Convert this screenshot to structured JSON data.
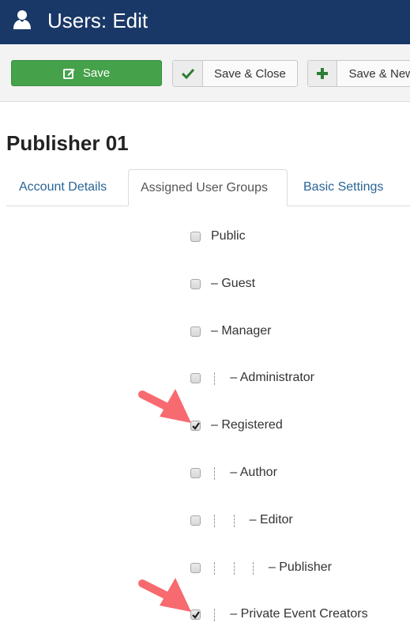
{
  "header": {
    "icon": "user-icon",
    "title": "Users: Edit",
    "background": "#1a3867"
  },
  "toolbar": {
    "save": {
      "label": "Save",
      "icon": "edit-icon",
      "color": "#45a24a"
    },
    "save_close": {
      "label": "Save & Close",
      "icon": "check-icon"
    },
    "save_new": {
      "label": "Save & New",
      "icon": "plus-icon"
    }
  },
  "page": {
    "title": "Publisher 01"
  },
  "tabs": [
    {
      "label": "Account Details",
      "active": false
    },
    {
      "label": "Assigned User Groups",
      "active": true
    },
    {
      "label": "Basic Settings",
      "active": false
    }
  ],
  "groups": [
    {
      "label": "Public",
      "level": 0,
      "checked": false,
      "highlighted": false
    },
    {
      "label": "– Guest",
      "level": 0,
      "checked": false,
      "highlighted": false
    },
    {
      "label": "– Manager",
      "level": 0,
      "checked": false,
      "highlighted": false
    },
    {
      "label": "– Administrator",
      "level": 1,
      "checked": false,
      "highlighted": false
    },
    {
      "label": "– Registered",
      "level": 0,
      "checked": true,
      "highlighted": true
    },
    {
      "label": "– Author",
      "level": 1,
      "checked": false,
      "highlighted": false
    },
    {
      "label": "– Editor",
      "level": 2,
      "checked": false,
      "highlighted": false
    },
    {
      "label": "– Publisher",
      "level": 3,
      "checked": false,
      "highlighted": false
    },
    {
      "label": "– Private Event Creators",
      "level": 1,
      "checked": true,
      "highlighted": true
    }
  ],
  "annotation_color": "#f76a6f"
}
